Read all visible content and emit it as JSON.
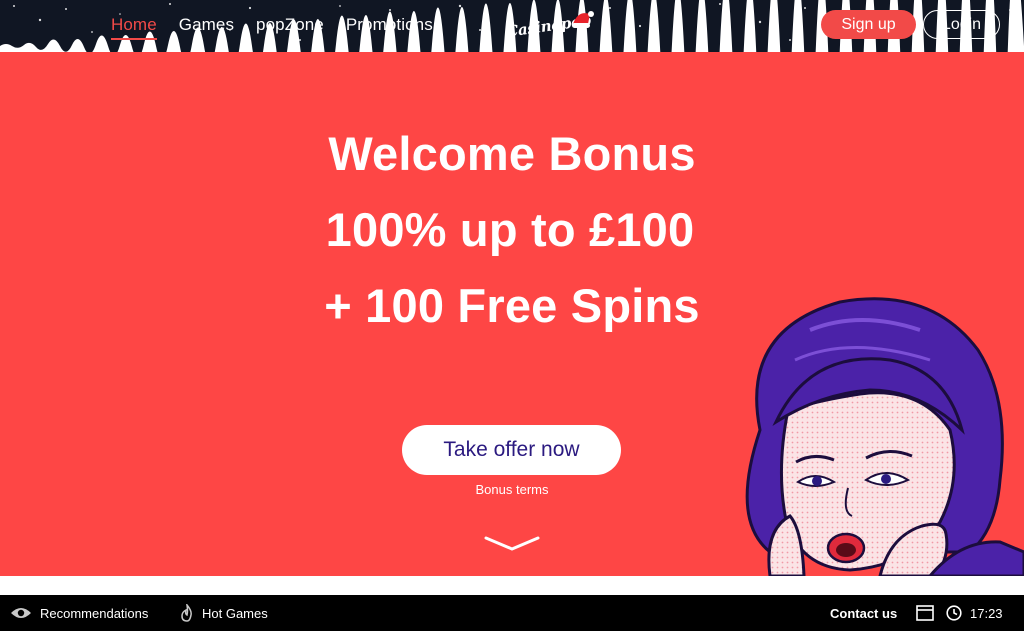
{
  "header": {
    "nav": [
      {
        "label": "Home",
        "active": true
      },
      {
        "label": "Games",
        "active": false
      },
      {
        "label": "popZone",
        "active": false
      },
      {
        "label": "Promotions",
        "active": false
      }
    ],
    "logo_text": "Casinopop",
    "signup_label": "Sign up",
    "login_label": "Login"
  },
  "hero": {
    "line1": "Welcome Bonus",
    "line2": "100% up to £100",
    "line3": "+ 100 Free Spins",
    "cta_label": "Take offer now",
    "terms_label": "Bonus terms",
    "scroll_icon": "chevron-down-icon"
  },
  "footer_bar": {
    "recommendations_label": "Recommendations",
    "recommendations_icon": "eye-icon",
    "hot_games_label": "Hot Games",
    "hot_games_icon": "flame-icon",
    "contact_label": "Contact us",
    "window_icon": "window-icon",
    "clock_icon": "clock-icon",
    "time": "17:23"
  },
  "colors": {
    "header_bg": "#101623",
    "hero_bg": "#fe4645",
    "accent_red": "#f24a48",
    "cta_text": "#2b1a80",
    "bottom_bar_bg": "#000000"
  }
}
